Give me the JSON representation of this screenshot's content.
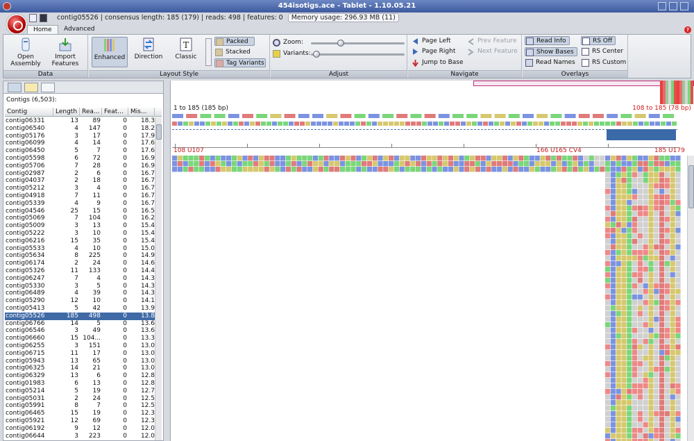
{
  "window": {
    "title": "454isotigs.ace - Tablet - 1.10.05.21"
  },
  "status": {
    "contig": "contig05526",
    "consensus": "consensus length: 185 (179)",
    "reads": "reads: 498",
    "features": "features: 0",
    "memory": "Memory usage: 296.93 MB (11)"
  },
  "ribbon_tabs": [
    "Home",
    "Advanced"
  ],
  "ribbon": {
    "data": {
      "label": "Data",
      "open_assembly": "Open Assembly",
      "import_features": "Import Features"
    },
    "layout": {
      "label": "Layout Style",
      "enhanced": "Enhanced",
      "direction": "Direction",
      "classic": "Classic",
      "packed": "Packed",
      "stacked": "Stacked",
      "tag_variants": "Tag Variants"
    },
    "adjust": {
      "label": "Adjust",
      "zoom": "Zoom:",
      "variants": "Variants:",
      "zoom_level": 0.3,
      "variants_level": 0.02
    },
    "navigate": {
      "label": "Navigate",
      "page_left": "Page Left",
      "page_right": "Page Right",
      "jump_to_base": "Jump to Base",
      "prev_feature": "Prev Feature",
      "next_feature": "Next Feature"
    },
    "overlays": {
      "label": "Overlays",
      "read_info": "Read Info",
      "show_bases": "Show Bases",
      "read_names": "Read Names",
      "rs_off": "RS Off",
      "rs_center": "RS Center",
      "rs_custom": "RS Custom"
    }
  },
  "contigs": {
    "count_label": "Contigs (6,503):",
    "columns": [
      "Contig",
      "Length",
      "Rea...",
      "Feat...",
      "Mis..."
    ],
    "rows": [
      [
        "contig06331",
        "13",
        "89",
        "0",
        "18.3"
      ],
      [
        "contig06540",
        "4",
        "147",
        "0",
        "18.2"
      ],
      [
        "contig05176",
        "3",
        "17",
        "0",
        "17.9"
      ],
      [
        "contig06099",
        "4",
        "14",
        "0",
        "17.6"
      ],
      [
        "contig06450",
        "5",
        "7",
        "0",
        "17.6"
      ],
      [
        "contig05598",
        "6",
        "72",
        "0",
        "16.9"
      ],
      [
        "contig05706",
        "7",
        "28",
        "0",
        "16.9"
      ],
      [
        "contig02987",
        "2",
        "6",
        "0",
        "16.7"
      ],
      [
        "contig04037",
        "2",
        "18",
        "0",
        "16.7"
      ],
      [
        "contig05212",
        "3",
        "4",
        "0",
        "16.7"
      ],
      [
        "contig04918",
        "7",
        "11",
        "0",
        "16.7"
      ],
      [
        "contig05339",
        "4",
        "9",
        "0",
        "16.7"
      ],
      [
        "contig04546",
        "25",
        "15",
        "0",
        "16.5"
      ],
      [
        "contig05069",
        "7",
        "104",
        "0",
        "16.2"
      ],
      [
        "contig05009",
        "3",
        "13",
        "0",
        "15.4"
      ],
      [
        "contig05222",
        "3",
        "10",
        "0",
        "15.4"
      ],
      [
        "contig06216",
        "15",
        "35",
        "0",
        "15.4"
      ],
      [
        "contig05533",
        "4",
        "10",
        "0",
        "15.0"
      ],
      [
        "contig05634",
        "8",
        "225",
        "0",
        "14.9"
      ],
      [
        "contig06174",
        "2",
        "24",
        "0",
        "14.6"
      ],
      [
        "contig05326",
        "11",
        "133",
        "0",
        "14.4"
      ],
      [
        "contig06247",
        "7",
        "4",
        "0",
        "14.3"
      ],
      [
        "contig05330",
        "3",
        "5",
        "0",
        "14.3"
      ],
      [
        "contig06489",
        "4",
        "39",
        "0",
        "14.3"
      ],
      [
        "contig05290",
        "12",
        "10",
        "0",
        "14.1"
      ],
      [
        "contig05413",
        "5",
        "42",
        "0",
        "13.9"
      ],
      [
        "contig05526",
        "185",
        "498",
        "0",
        "13.8"
      ],
      [
        "contig06766",
        "14",
        "5",
        "0",
        "13.6"
      ],
      [
        "contig06546",
        "3",
        "49",
        "0",
        "13.6"
      ],
      [
        "contig06660",
        "15",
        "104...",
        "0",
        "13.3"
      ],
      [
        "contig06255",
        "3",
        "151",
        "0",
        "13.0"
      ],
      [
        "contig06715",
        "11",
        "17",
        "0",
        "13.0"
      ],
      [
        "contig05943",
        "13",
        "65",
        "0",
        "13.0"
      ],
      [
        "contig06325",
        "14",
        "21",
        "0",
        "13.0"
      ],
      [
        "contig06329",
        "13",
        "6",
        "0",
        "12.8"
      ],
      [
        "contig01983",
        "6",
        "13",
        "0",
        "12.8"
      ],
      [
        "contig05214",
        "5",
        "19",
        "0",
        "12.7"
      ],
      [
        "contig05031",
        "2",
        "24",
        "0",
        "12.5"
      ],
      [
        "contig05991",
        "8",
        "7",
        "0",
        "12.5"
      ],
      [
        "contig06465",
        "15",
        "19",
        "0",
        "12.3"
      ],
      [
        "contig05921",
        "12",
        "69",
        "0",
        "12.3"
      ],
      [
        "contig06192",
        "9",
        "12",
        "0",
        "12.0"
      ],
      [
        "contig06644",
        "3",
        "223",
        "0",
        "12.0"
      ]
    ],
    "selected_index": 26
  },
  "viewer": {
    "range_left": "1 to 185 (185 bp)",
    "range_right": "108 to 185 (78 bp)",
    "pos_labels": [
      "108 U107",
      "166 U165 CV4",
      "185 U179"
    ],
    "colors": {
      "A": "#7ad67a",
      "C": "#7b93e0",
      "G": "#e07b7b",
      "T": "#d6c86e",
      "grey": "#d0d0d0"
    }
  }
}
